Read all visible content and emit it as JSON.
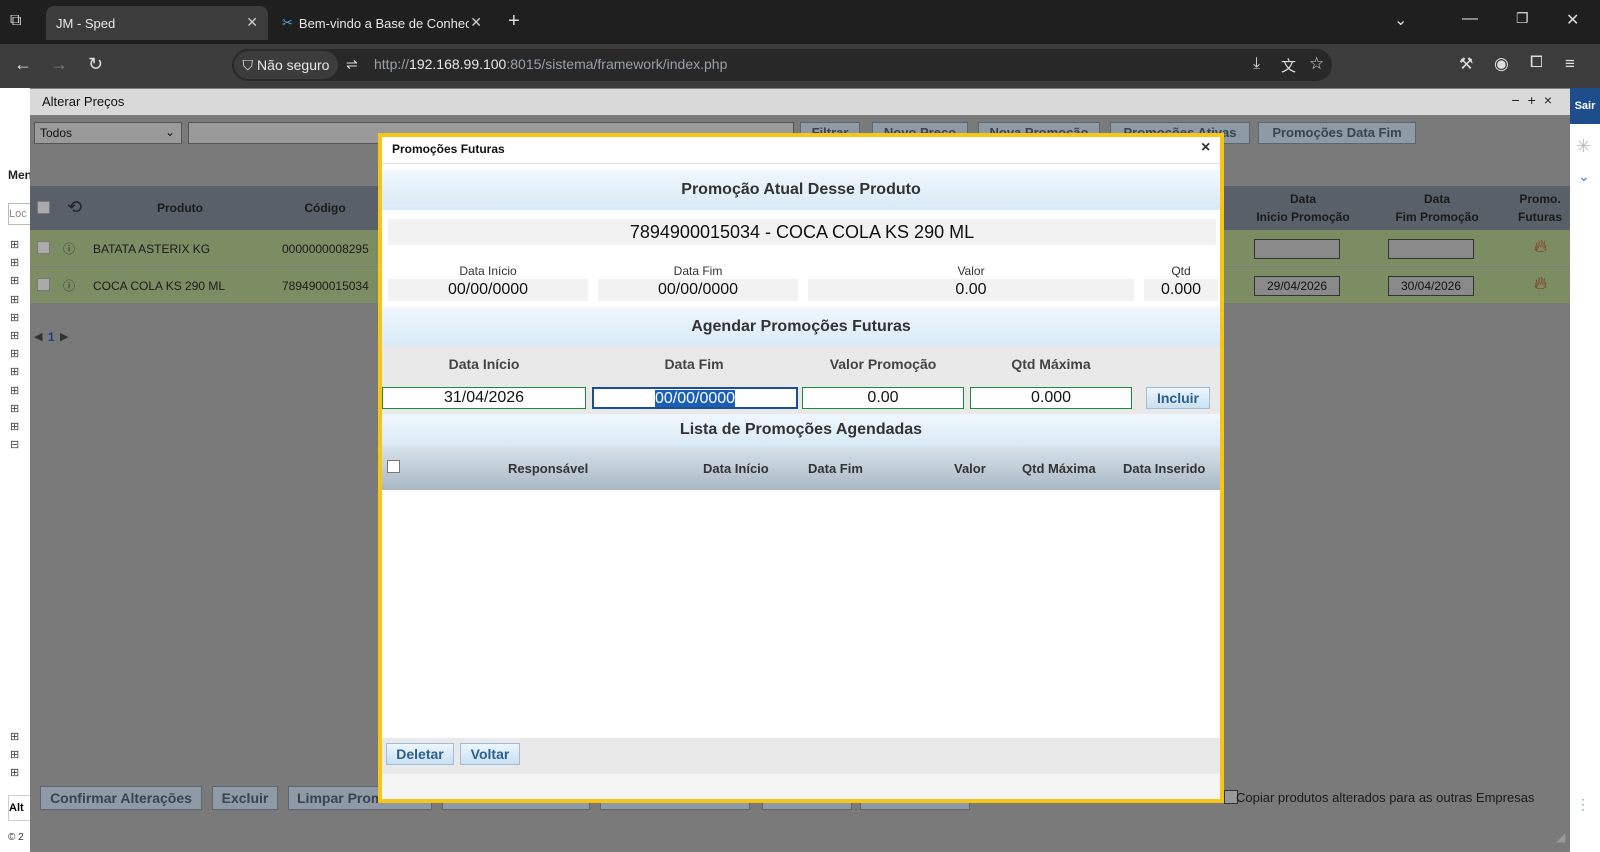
{
  "browser": {
    "tabs": [
      {
        "label": "JM - Sped"
      },
      {
        "label": "Bem-vindo a Base de Conhecim"
      }
    ],
    "security_label": "Não seguro",
    "url_prefix": "http://",
    "url_host": "192.168.99.100",
    "url_rest": ":8015/sistema/framework/index.php"
  },
  "app": {
    "sair_label": "Sair",
    "left_labels": {
      "menu": "Men",
      "locate": "Loc",
      "bottom": "Alt",
      "copyright": "© 2"
    },
    "window_title": "Alterar Preços",
    "filter_select": "Todos",
    "toolbar_buttons": [
      "Filtrar",
      "Novo Preço",
      "Nova Promoção",
      "Promoções Ativas",
      "Promoções Data Fim"
    ],
    "grid": {
      "headers": {
        "produto": "Produto",
        "codigo": "Código",
        "data_inicio_l1": "Data",
        "data_inicio_l2": "Inicio Promoção",
        "data_fim_l1": "Data",
        "data_fim_l2": "Fim Promoção",
        "promo_l1": "Promo.",
        "promo_l2": "Futuras"
      },
      "rows": [
        {
          "produto": "BATATA ASTERIX KG",
          "codigo": "0000000008295",
          "data_inicio": "",
          "data_fim": ""
        },
        {
          "produto": "COCA COLA KS 290 ML",
          "codigo": "7894900015034",
          "data_inicio": "29/04/2026",
          "data_fim": "30/04/2026"
        }
      ],
      "pager_page": "1"
    },
    "bottom_buttons": [
      "Confirmar Alterações",
      "Excluir",
      "Limpar Prom"
    ],
    "copy_label": "Copiar produtos alterados para as outras Empresas"
  },
  "modal": {
    "title": "Promoções Futuras",
    "current": {
      "heading": "Promoção Atual Desse Produto",
      "product": "7894900015034 - COCA COLA  KS 290 ML",
      "labels": {
        "inicio": "Data Início",
        "fim": "Data Fim",
        "valor": "Valor",
        "qtd": "Qtd"
      },
      "values": {
        "inicio": "00/00/0000",
        "fim": "00/00/0000",
        "valor": "0.00",
        "qtd": "0.000"
      }
    },
    "schedule": {
      "heading": "Agendar Promoções Futuras",
      "labels": {
        "inicio": "Data Início",
        "fim": "Data Fim",
        "valor": "Valor Promoção",
        "qtd": "Qtd Máxima"
      },
      "values": {
        "inicio": "31/04/2026",
        "fim": "00/00/0000",
        "valor": "0.00",
        "qtd": "0.000"
      },
      "include_label": "Incluir"
    },
    "list": {
      "heading": "Lista de Promoções Agendadas",
      "columns": {
        "responsavel": "Responsável",
        "inicio": "Data Início",
        "fim": "Data Fim",
        "valor": "Valor",
        "qtd": "Qtd Máxima",
        "inserido": "Data Inserido"
      },
      "delete_label": "Deletar",
      "back_label": "Voltar"
    }
  }
}
